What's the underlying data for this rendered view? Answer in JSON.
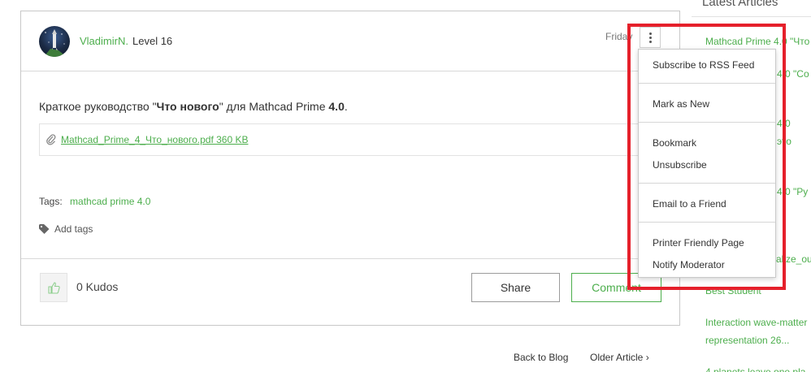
{
  "post": {
    "author": "VladimirN.",
    "level": "Level 16",
    "date": "Friday",
    "body_prefix": "Краткое руководство \"",
    "body_bold": "Что нового",
    "body_mid": "\" для Mathcad Prime ",
    "body_version": "4.0",
    "body_suffix": ".",
    "attachment": "Mathcad_Prime_4_Что_нового.pdf 360 KB",
    "tags_label": "Tags:",
    "tag": "mathcad prime 4.0",
    "add_tags": "Add tags",
    "kudos": "0 Kudos",
    "share": "Share",
    "comment": "Comment"
  },
  "pager": {
    "back": "Back to Blog",
    "older": "Older Article  ›"
  },
  "sidebar": {
    "title": "Latest Articles",
    "items": [
      "Mathcad Prime 4.0 \"Что",
      "4.0 \"Co",
      "4.0",
      "это",
      "4.0 \"Ру",
      "alize_out",
      "Best Student",
      "Interaction wave-matter",
      "representation 26...",
      "4 planets leave one pla"
    ]
  },
  "menu": {
    "items": [
      "Subscribe to RSS Feed",
      "Mark as New",
      "Bookmark",
      "Unsubscribe",
      "Email to a Friend",
      "Printer Friendly Page",
      "Notify Moderator"
    ]
  },
  "colors": {
    "accent_green": "#4cae4c",
    "highlight_red": "#e5202b"
  }
}
